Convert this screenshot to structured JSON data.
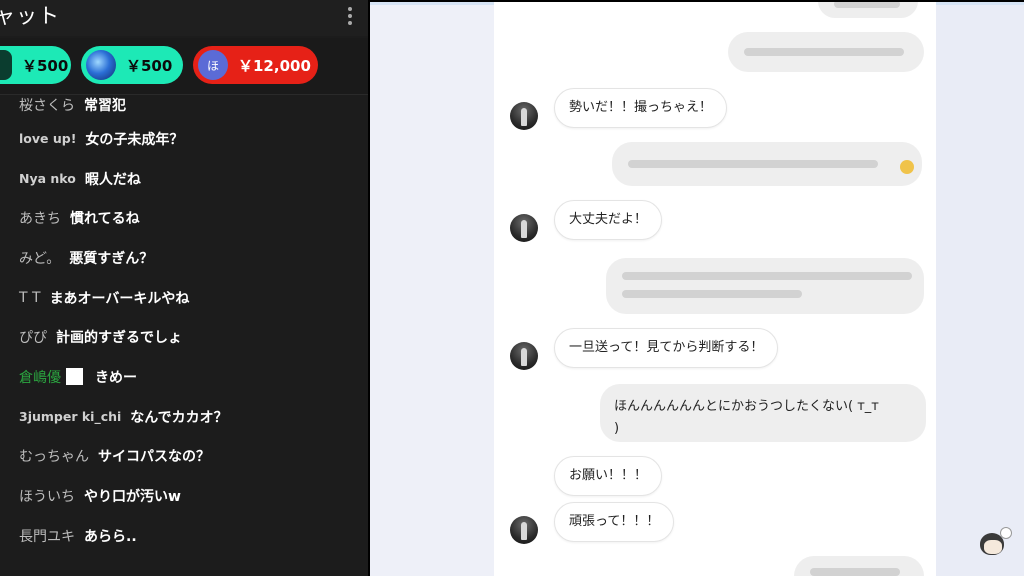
{
  "chat": {
    "title": "ャット",
    "superchats": [
      {
        "amount": "￥500",
        "color": "#1de9b6"
      },
      {
        "amount": "￥500",
        "color": "#1de9b6"
      },
      {
        "amount": "￥12,000",
        "avatar_letter": "ほ",
        "color": "#e62117"
      }
    ],
    "messages": [
      {
        "author": "桜さくら",
        "text": "常習犯"
      },
      {
        "author": "love up!",
        "text": "女の子未成年？"
      },
      {
        "author": "Nya nko",
        "text": "暇人だね"
      },
      {
        "author": "あきち",
        "text": "慣れてるね"
      },
      {
        "author": "みど。",
        "text": "悪質すぎん？"
      },
      {
        "author": "T T",
        "text": "まあオーバーキルやね"
      },
      {
        "author": "ぴぴ",
        "text": "計画的すぎるでしょ"
      },
      {
        "author": "倉嶋優",
        "text": "きめー"
      },
      {
        "author": "3jumper ki_chi",
        "text": "なんでカカオ？"
      },
      {
        "author": "むっちゃん",
        "text": "サイコパスなの？"
      },
      {
        "author": "ほういち",
        "text": "やり口が汚いw"
      },
      {
        "author": "長門ユキ",
        "text": "あらら.."
      }
    ]
  },
  "conversation": {
    "incoming": [
      "勢いだ！！撮っちゃえ！",
      "大丈夫だよ！",
      "一旦送って！見てから判断する！",
      "お願い！！！",
      "頑張って！！！"
    ],
    "outgoing_text": "ほんんんんんんとにかおうつしたくない( т_т\n)"
  },
  "colors": {
    "chat_bg": "#1c1c1c",
    "superchat_teal": "#1de9b6",
    "superchat_red": "#e62117",
    "member_name": "#2ba640",
    "app_bg": "#e9ecf6"
  },
  "icons": {
    "menu": "more-vert-icon",
    "user": "user-avatar-icon"
  }
}
